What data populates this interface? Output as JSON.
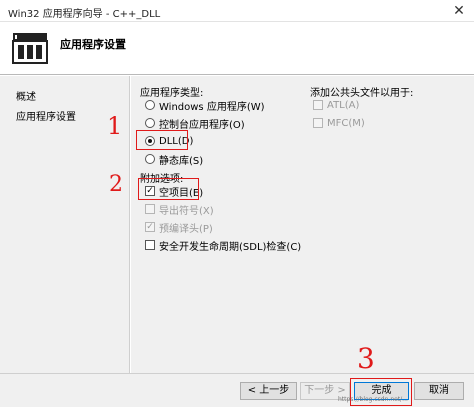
{
  "window": {
    "title": "Win32 应用程序向导 - C++_DLL",
    "close_glyph": "✕"
  },
  "header": {
    "title": "应用程序设置",
    "logo_icon": "wizard-windows-icon"
  },
  "sidebar": {
    "items": [
      {
        "label": "概述"
      },
      {
        "label": "应用程序设置"
      }
    ]
  },
  "app_type": {
    "label": "应用程序类型:",
    "options": [
      {
        "label": "Windows 应用程序(W)",
        "selected": false
      },
      {
        "label": "控制台应用程序(O)",
        "selected": false
      },
      {
        "label": "DLL(D)",
        "selected": true
      },
      {
        "label": "静态库(S)",
        "selected": false
      }
    ]
  },
  "common_headers": {
    "label": "添加公共头文件以用于:",
    "options": [
      {
        "label": "ATL(A)",
        "checked": false,
        "enabled": false
      },
      {
        "label": "MFC(M)",
        "checked": false,
        "enabled": false
      }
    ]
  },
  "extra_options": {
    "label": "附加选项:",
    "options": [
      {
        "label": "空项目(E)",
        "checked": true,
        "enabled": true
      },
      {
        "label": "导出符号(X)",
        "checked": false,
        "enabled": false
      },
      {
        "label": "预编译头(P)",
        "checked": true,
        "enabled": false
      },
      {
        "label": "安全开发生命周期(SDL)检查(C)",
        "checked": false,
        "enabled": true
      }
    ]
  },
  "annotations": {
    "one": "1",
    "two": "2",
    "three": "3",
    "color": "#e01a1a"
  },
  "footer": {
    "prev_label": "< 上一步",
    "next_label": "下一步 >",
    "finish_label": "完成",
    "cancel_label": "取消"
  },
  "watermark": "https://blog.csdn.net/..."
}
